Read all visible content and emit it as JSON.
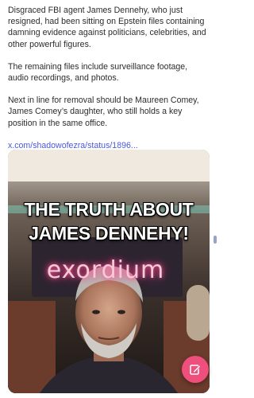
{
  "post": {
    "paragraphs": [
      "Disgraced FBI agent James Dennehy, who just resigned, had been sitting on Epstein files containing damning evidence against politicians, celebrities, and other powerful figures.",
      "The remaining files include surveillance footage, audio recordings, and photos.",
      "Next in line for removal should be Maureen Comey, James Comey’s daughter, who still holds a key position in the same office."
    ],
    "link_text": "x.com/shadowofezra/status/1896..."
  },
  "video": {
    "caption_line1": "THE TRUTH ABOUT",
    "caption_line2": "JAMES DENNEHY!",
    "neon_sign": "exordium"
  },
  "fab": {
    "icon": "compose-pencil-icon",
    "color": "#ef4f7c"
  }
}
